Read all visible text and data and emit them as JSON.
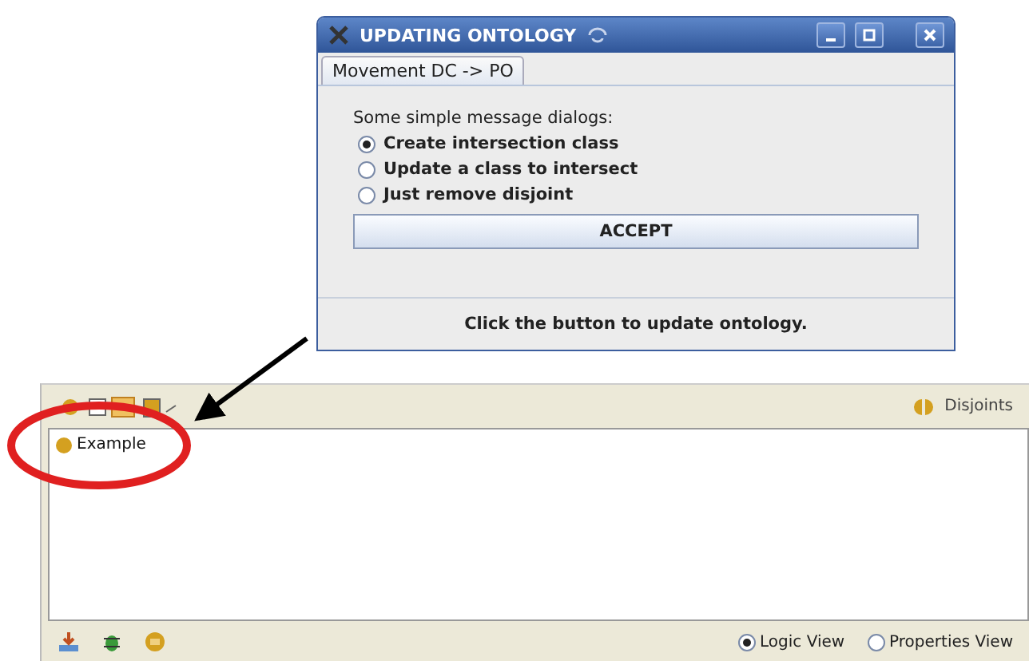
{
  "dialog": {
    "title": "UPDATING ONTOLOGY",
    "tabs": [
      {
        "label": "Movement DC -> PO",
        "selected": true
      }
    ],
    "prompt": "Some simple message dialogs:",
    "options": [
      {
        "label": "Create intersection class",
        "selected": true
      },
      {
        "label": "Update a class to intersect",
        "selected": false
      },
      {
        "label": "Just remove disjoint",
        "selected": false
      }
    ],
    "button": "ACCEPT",
    "status": "Click the button to update ontology."
  },
  "panel": {
    "legend": "Disjoints",
    "tree": [
      {
        "label": "Example"
      }
    ],
    "views": [
      {
        "label": "Logic View",
        "selected": true
      },
      {
        "label": "Properties View",
        "selected": false
      }
    ]
  }
}
